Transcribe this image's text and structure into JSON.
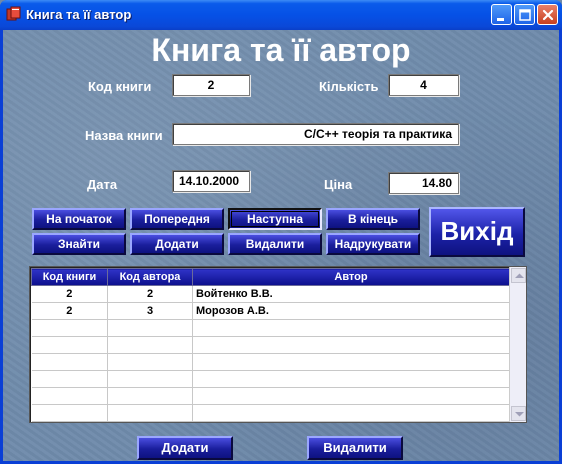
{
  "window": {
    "title": "Книга та її автор"
  },
  "heading": "Книга та її автор",
  "form": {
    "book_code_label": "Код книги",
    "book_code_value": "2",
    "quantity_label": "Кількість",
    "quantity_value": "4",
    "book_name_label": "Назва книги",
    "book_name_value": "C/C++ теорія та практика",
    "date_label": "Дата",
    "date_value": "14.10.2000",
    "price_label": "Ціна",
    "price_value": "14.80"
  },
  "nav": {
    "first": "На початок",
    "prev": "Попередня",
    "next": "Наступна",
    "last": "В кінець",
    "find": "Знайти",
    "add": "Додати",
    "delete": "Видалити",
    "print": "Надрукувати",
    "exit": "Вихід"
  },
  "grid": {
    "headers": [
      "Код книги",
      "Код  автора",
      "Автор"
    ],
    "rows": [
      [
        "2",
        "2",
        "Войтенко В.В."
      ],
      [
        "2",
        "3",
        "Морозов А.В."
      ]
    ]
  },
  "bottom": {
    "add": "Додати",
    "delete": "Видалити"
  },
  "colors": {
    "titlebar": "#0a5bea",
    "button_blue": "#1a1e9c",
    "background": "#6f8bab"
  }
}
